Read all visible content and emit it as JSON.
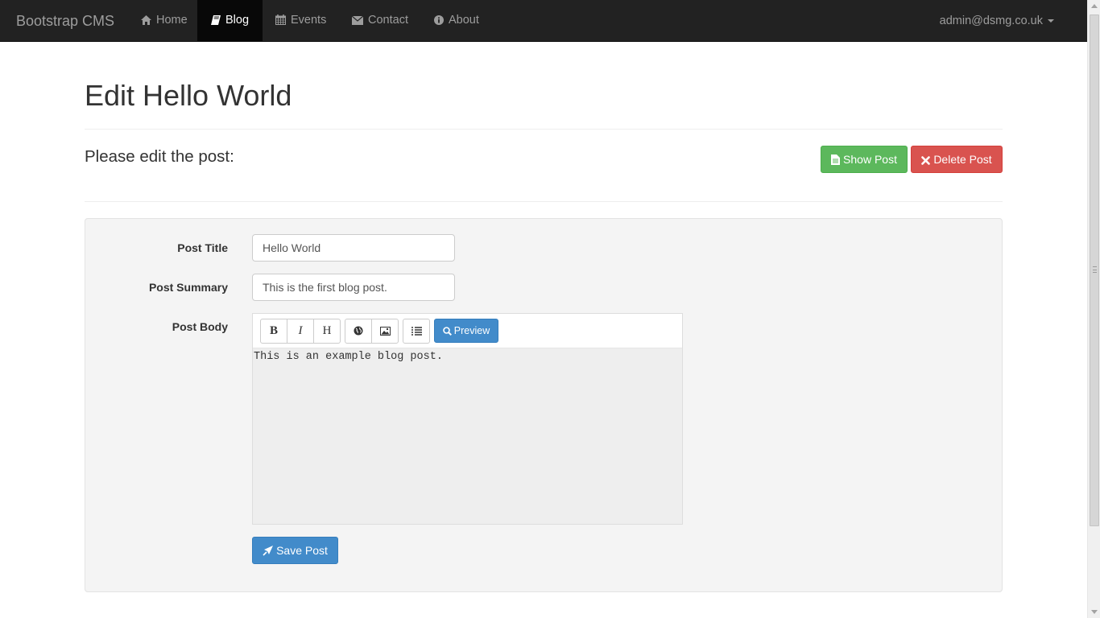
{
  "navbar": {
    "brand": "Bootstrap CMS",
    "items": [
      {
        "label": "Home",
        "icon": "home-icon"
      },
      {
        "label": "Blog",
        "icon": "book-icon"
      },
      {
        "label": "Events",
        "icon": "calendar-icon"
      },
      {
        "label": "Contact",
        "icon": "envelope-icon"
      },
      {
        "label": "About",
        "icon": "info-icon"
      }
    ],
    "active": "Blog",
    "user": "admin@dsmg.co.uk"
  },
  "page": {
    "title": "Edit Hello World",
    "subtitle": "Please edit the post:",
    "show_post_label": "Show Post",
    "delete_post_label": "Delete Post"
  },
  "form": {
    "title_label": "Post Title",
    "title_value": "Hello World",
    "summary_label": "Post Summary",
    "summary_value": "This is the first blog post.",
    "body_label": "Post Body",
    "toolbar": {
      "bold": "B",
      "italic": "I",
      "heading": "H",
      "preview": "Preview"
    },
    "body_value": "This is an example blog post.",
    "save_label": "Save Post"
  },
  "colors": {
    "navbar_bg": "#222222",
    "success": "#5cb85c",
    "danger": "#d9534f",
    "primary": "#428bca"
  }
}
